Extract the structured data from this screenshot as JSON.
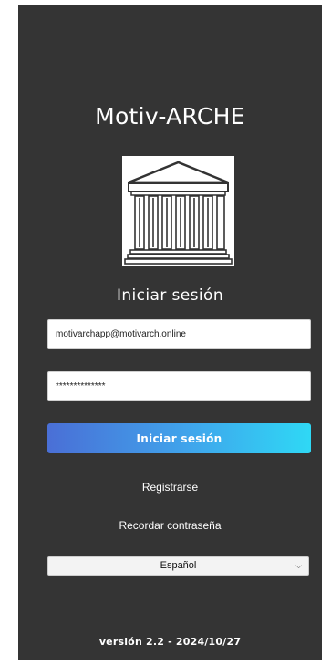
{
  "app": {
    "title": "Motiv-ARCHE",
    "logo": "classical-temple-icon"
  },
  "login": {
    "heading": "Iniciar sesión",
    "email_value": "motivarchapp@motivarch.online",
    "password_value": "**************",
    "submit_label": "Iniciar sesión",
    "register_label": "Registrarse",
    "recover_label": "Recordar contraseña"
  },
  "language": {
    "selected": "Español"
  },
  "footer": {
    "version": "versión 2.2 - 2024/10/27"
  },
  "colors": {
    "background": "#343434",
    "button_gradient_start": "#4a6fd6",
    "button_gradient_end": "#2fd8f5"
  }
}
